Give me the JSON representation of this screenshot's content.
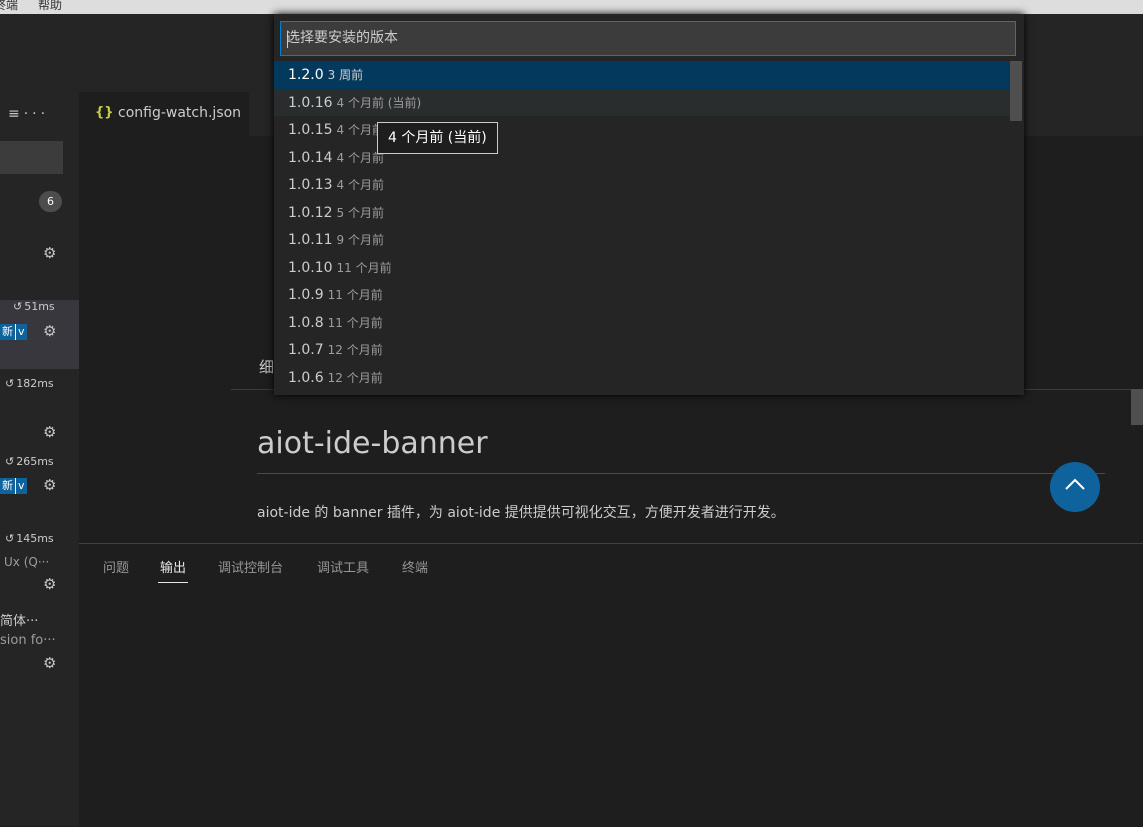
{
  "menubar": {
    "items": [
      "终端",
      "帮助"
    ]
  },
  "sidebar": {
    "badge_count": "6",
    "item1_time": "51ms",
    "item1_update": "新",
    "item2_time": "182ms",
    "item3_time": "265ms",
    "item3_update": "新",
    "item4_time": "145ms",
    "item4_desc": "Ux (Q···",
    "item5_title": "简体···",
    "item5_desc": "sion fo···"
  },
  "editor": {
    "tab_label": "config-watch.json",
    "section_title": "细",
    "ext_title": "aiot-ide-banner",
    "ext_desc": "aiot-ide 的 banner 插件，为 aiot-ide 提供提供可视化交互，方便开发者进行开发。"
  },
  "panel": {
    "tabs": [
      "问题",
      "输出",
      "调试控制台",
      "调试工具",
      "终端"
    ],
    "active_tab": "输出"
  },
  "quickpick": {
    "placeholder": "选择要安装的版本",
    "items": [
      {
        "version": "1.2.0",
        "date": "3 周前"
      },
      {
        "version": "1.0.16",
        "date": "4 个月前 (当前)"
      },
      {
        "version": "1.0.15",
        "date": "4 个月前"
      },
      {
        "version": "1.0.14",
        "date": "4 个月前"
      },
      {
        "version": "1.0.13",
        "date": "4 个月前"
      },
      {
        "version": "1.0.12",
        "date": "5 个月前"
      },
      {
        "version": "1.0.11",
        "date": "9 个月前"
      },
      {
        "version": "1.0.10",
        "date": "11 个月前"
      },
      {
        "version": "1.0.9",
        "date": "11 个月前"
      },
      {
        "version": "1.0.8",
        "date": "11 个月前"
      },
      {
        "version": "1.0.7",
        "date": "12 个月前"
      },
      {
        "version": "1.0.6",
        "date": "12 个月前"
      }
    ],
    "tooltip": "4 个月前 (当前)"
  },
  "colors": {
    "accent": "#0e639c",
    "selection": "#04395e",
    "focus_border": "#007fd4"
  }
}
